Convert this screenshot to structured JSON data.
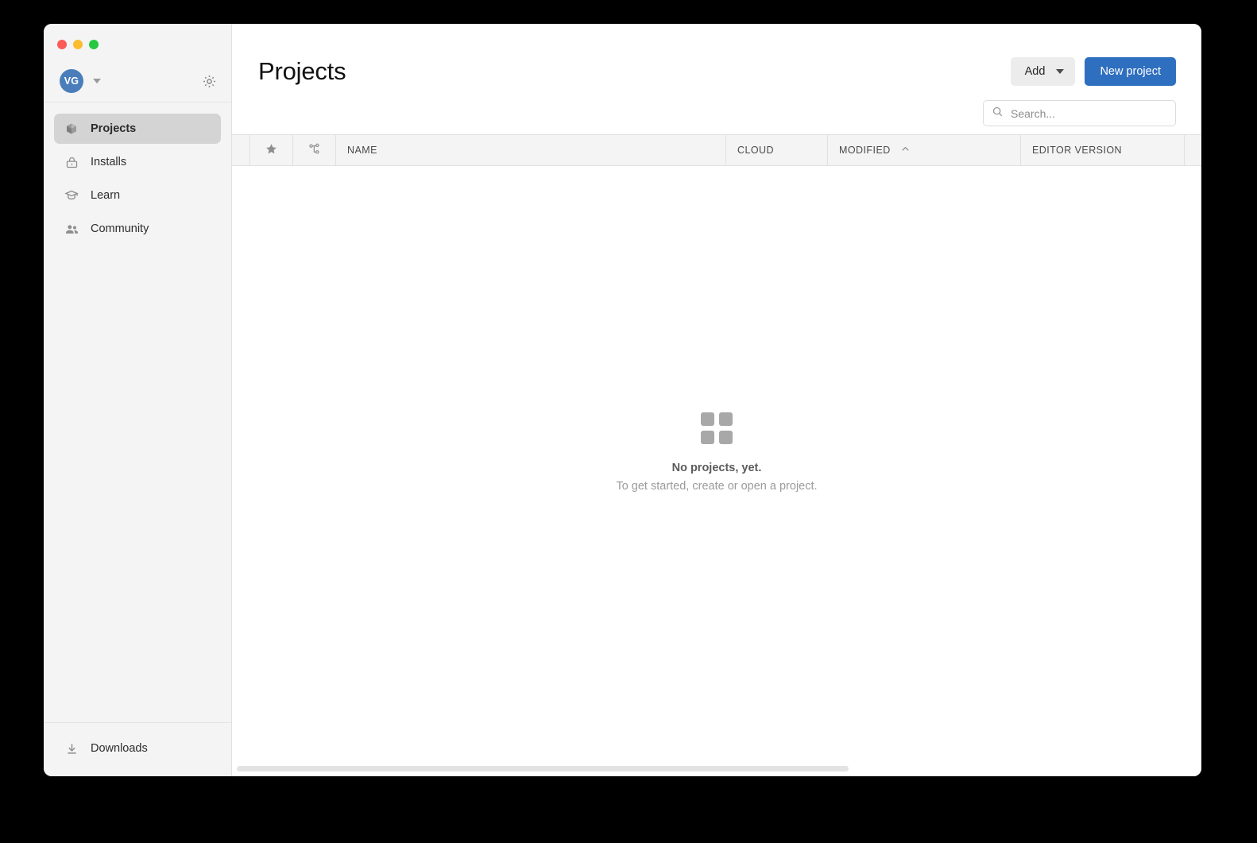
{
  "window": {
    "traffic_lights": [
      {
        "name": "close",
        "color": "#fc5b57"
      },
      {
        "name": "minimize",
        "color": "#fbbd2e"
      },
      {
        "name": "maximize",
        "color": "#25c83f"
      }
    ]
  },
  "sidebar": {
    "account": {
      "avatar_initials": "VG",
      "avatar_color": "#4a7ebb",
      "caret_icon": "chevron-down-icon",
      "settings_icon": "gear-icon"
    },
    "items": [
      {
        "label": "Projects",
        "icon": "cube-icon",
        "active": true
      },
      {
        "label": "Installs",
        "icon": "archive-icon",
        "active": false
      },
      {
        "label": "Learn",
        "icon": "graduation-cap-icon",
        "active": false
      },
      {
        "label": "Community",
        "icon": "people-icon",
        "active": false
      }
    ],
    "footer": {
      "label": "Downloads",
      "icon": "download-icon"
    }
  },
  "header": {
    "title": "Projects",
    "add_label": "Add",
    "new_project_label": "New project",
    "accent_color": "#2f6fc0"
  },
  "search": {
    "placeholder": "Search...",
    "value": "",
    "icon": "search-icon"
  },
  "table": {
    "columns": [
      {
        "label": "",
        "name": "spacer"
      },
      {
        "label": "",
        "name": "favorite",
        "icon": "star-icon"
      },
      {
        "label": "",
        "name": "version-control",
        "icon": "git-branch-icon"
      },
      {
        "label": "NAME",
        "name": "name"
      },
      {
        "label": "CLOUD",
        "name": "cloud"
      },
      {
        "label": "MODIFIED",
        "name": "modified",
        "sort": "asc",
        "sort_icon": "chevron-up-icon"
      },
      {
        "label": "EDITOR VERSION",
        "name": "editor-version"
      },
      {
        "label": "",
        "name": "trailing"
      }
    ],
    "rows": []
  },
  "empty_state": {
    "icon": "grid-squares-icon",
    "title": "No projects, yet.",
    "subtitle": "To get started, create or open a project."
  }
}
